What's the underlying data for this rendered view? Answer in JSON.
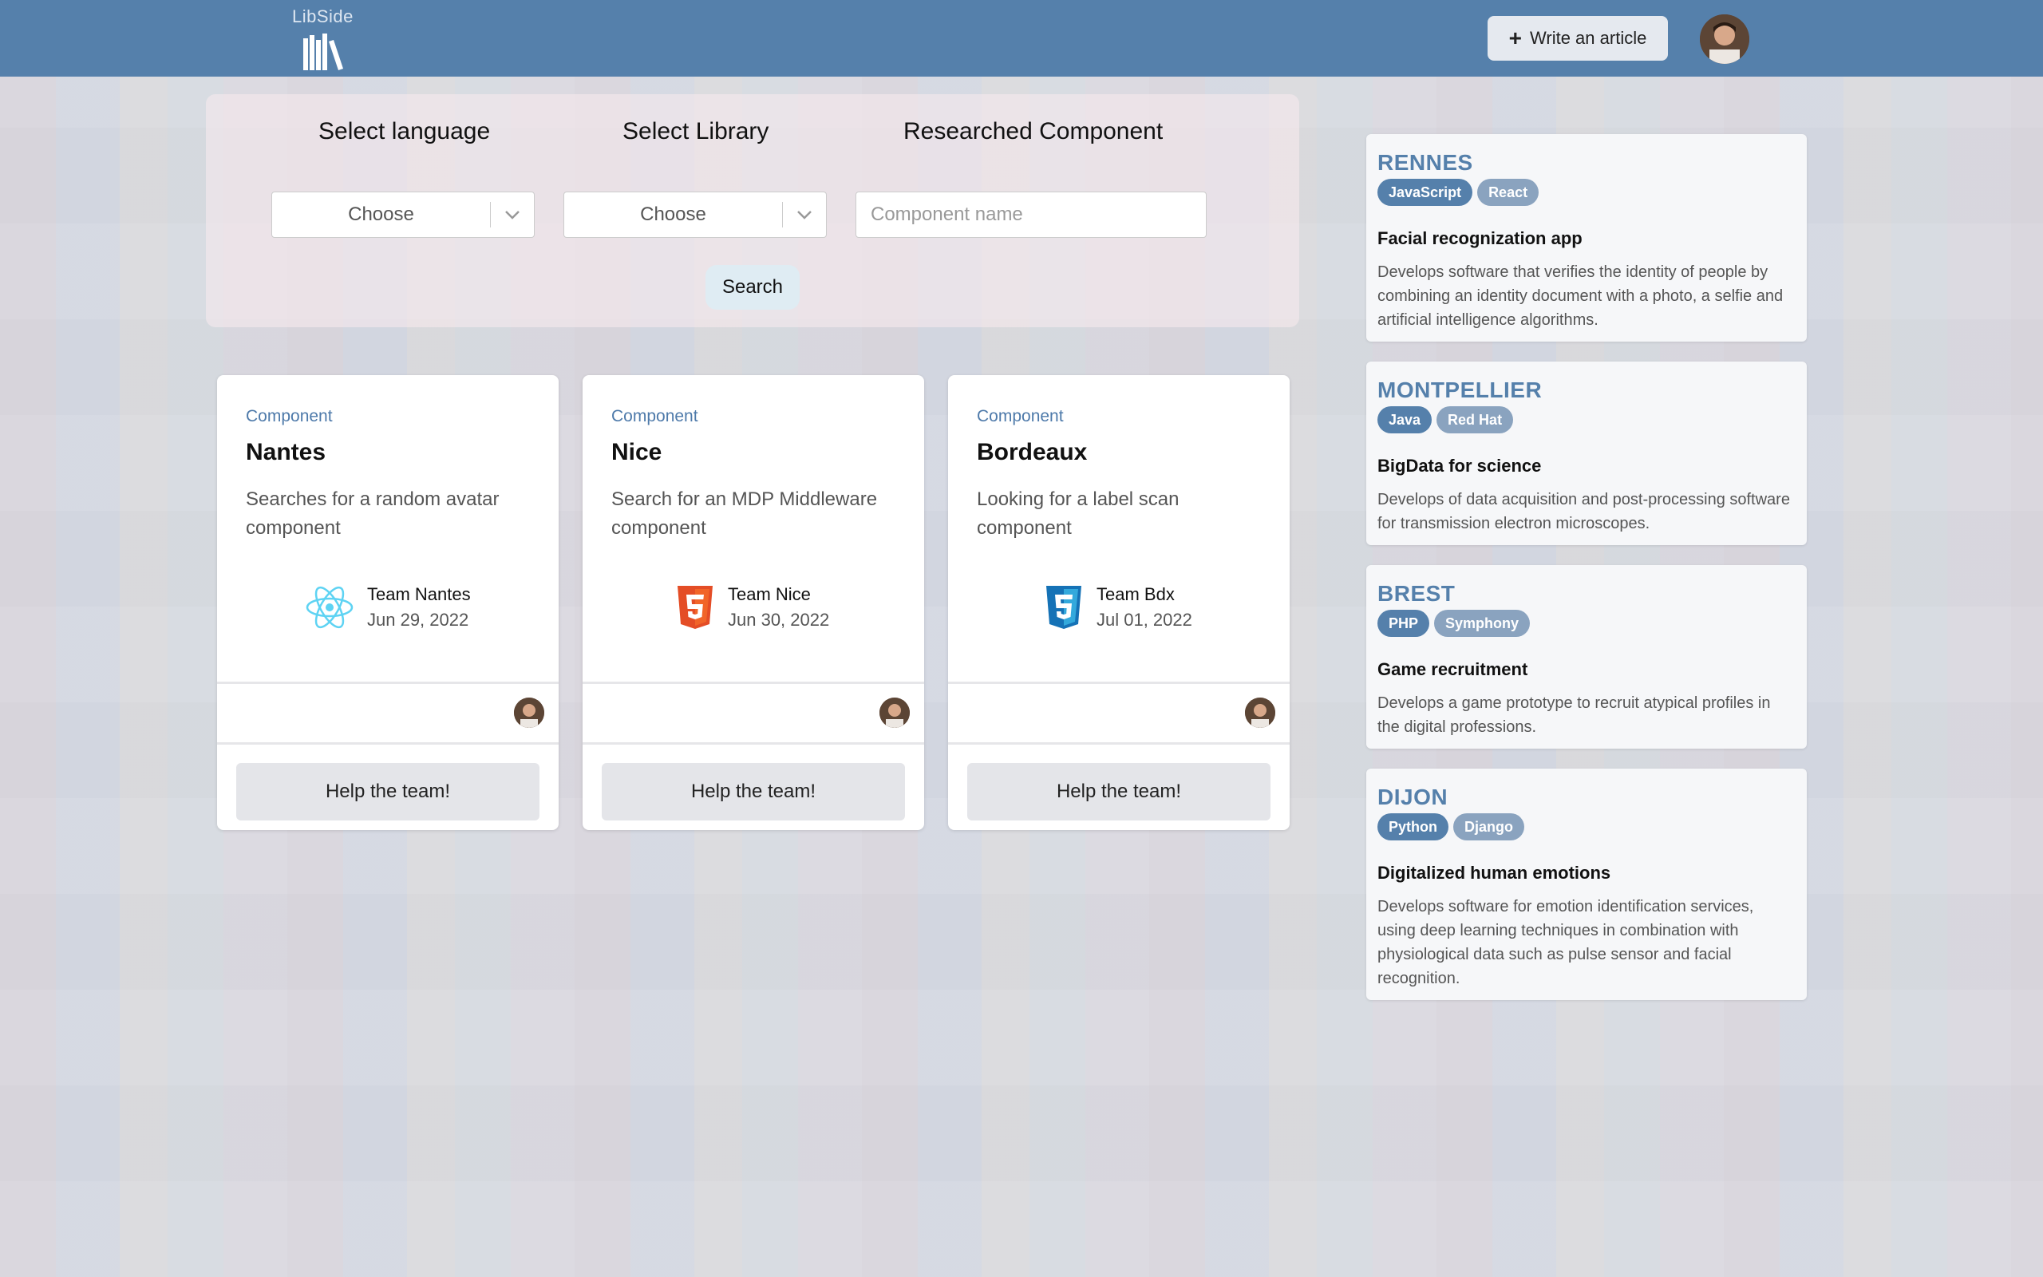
{
  "header": {
    "logo_text": "LibSide",
    "write_button": "Write an article",
    "write_icon": "plus-icon"
  },
  "search": {
    "language_label": "Select language",
    "library_label": "Select Library",
    "component_label": "Researched Component",
    "language_value": "Choose",
    "library_value": "Choose",
    "component_placeholder": "Component name",
    "search_button": "Search"
  },
  "cards": [
    {
      "kind": "Component",
      "title": "Nantes",
      "desc": "Searches for a random avatar component",
      "icon": "react-icon",
      "team": "Team Nantes",
      "date": "Jun 29, 2022",
      "help": "Help the team!"
    },
    {
      "kind": "Component",
      "title": "Nice",
      "desc": "Search for an MDP Middleware component",
      "icon": "html5-icon",
      "team": "Team Nice",
      "date": "Jun 30, 2022",
      "help": "Help the team!"
    },
    {
      "kind": "Component",
      "title": "Bordeaux",
      "desc": "Looking for a label scan component",
      "icon": "css3-icon",
      "team": "Team Bdx",
      "date": "Jul 01, 2022",
      "help": "Help the team!"
    }
  ],
  "sidebar": [
    {
      "city": "RENNES",
      "tags": [
        "JavaScript",
        "React"
      ],
      "title": "Facial recognization app",
      "desc": "Develops software that verifies the identity of people by combining an identity document with a photo, a selfie and artificial intelligence algorithms."
    },
    {
      "city": "MONTPELLIER",
      "tags": [
        "Java",
        "Red Hat"
      ],
      "title": "BigData for science",
      "desc": "Develops of data acquisition and post-processing software for transmission electron microscopes."
    },
    {
      "city": "BREST",
      "tags": [
        "PHP",
        "Symphony"
      ],
      "title": "Game recruitment",
      "desc": "Develops a game prototype to recruit atypical profiles in the digital professions."
    },
    {
      "city": "DIJON",
      "tags": [
        "Python",
        "Django"
      ],
      "title": "Digitalized human emotions",
      "desc": "Develops software for emotion identification services, using deep learning techniques in combination with physiological data such as pulse sensor and facial recognition."
    }
  ],
  "colors": {
    "accent": "#5580ab",
    "tag_light": "#8aa3bf"
  }
}
